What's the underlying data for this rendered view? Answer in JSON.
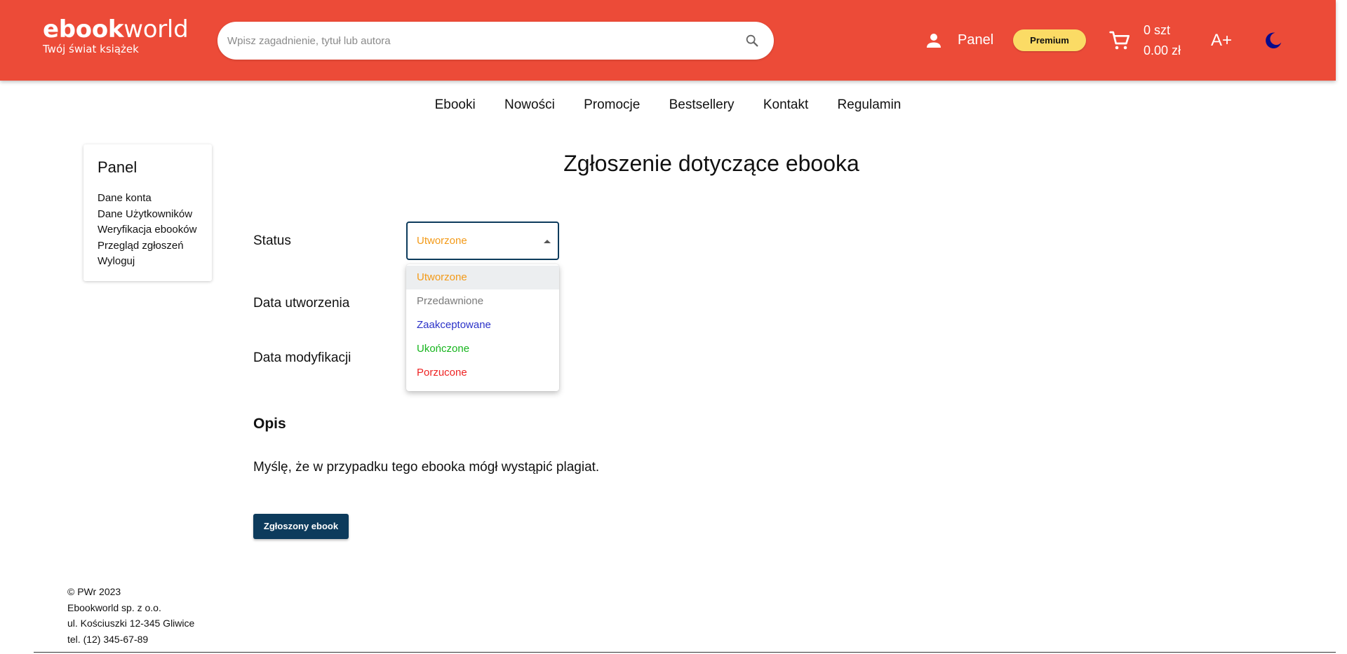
{
  "header": {
    "logo_bold": "ebook",
    "logo_light": "world",
    "logo_tagline": "Twój świat książek",
    "search_placeholder": "Wpisz zagadnienie, tytuł lub autora",
    "panel_label": "Panel",
    "premium_label": "Premium",
    "cart_count": "0 szt",
    "cart_total": "0.00 zł",
    "font_size_label": "A+",
    "accent_color": "#ec4b38",
    "theme_icon_color": "#0a0a8c"
  },
  "nav": {
    "items": [
      "Ebooki",
      "Nowości",
      "Promocje",
      "Bestsellery",
      "Kontakt",
      "Regulamin"
    ]
  },
  "sidebar": {
    "title": "Panel",
    "items": [
      "Dane konta",
      "Dane Użytkowników",
      "Weryfikacja ebooków",
      "Przegląd zgłoszeń",
      "Wyloguj"
    ]
  },
  "main": {
    "title": "Zgłoszenie dotyczące ebooka",
    "status_label": "Status",
    "status_value": "Utworzone",
    "created_label": "Data utworzenia",
    "modified_label": "Data modyfikacji",
    "description_heading": "Opis",
    "description_text": "Myślę, że w przypadku tego ebooka mógł wystąpić plagiat.",
    "report_button_label": "Zgłoszony ebook"
  },
  "status_options": [
    {
      "label": "Utworzone",
      "color": "#f39a18",
      "selected": true
    },
    {
      "label": "Przedawnione",
      "color": "#7a7a7a",
      "selected": false
    },
    {
      "label": "Zaakceptowane",
      "color": "#2b32c8",
      "selected": false
    },
    {
      "label": "Ukończone",
      "color": "#16b51d",
      "selected": false
    },
    {
      "label": "Porzucone",
      "color": "#ee2424",
      "selected": false
    }
  ],
  "footer": {
    "lines": [
      "© PWr 2023",
      "Ebookworld sp. z o.o.",
      "ul. Kościuszki 12-345 Gliwice",
      "tel. (12) 345-67-89"
    ]
  },
  "icons": {
    "search": "search-icon",
    "user": "person-icon",
    "cart": "cart-icon",
    "theme": "moon-icon",
    "dropdown": "triangle-up-icon"
  }
}
